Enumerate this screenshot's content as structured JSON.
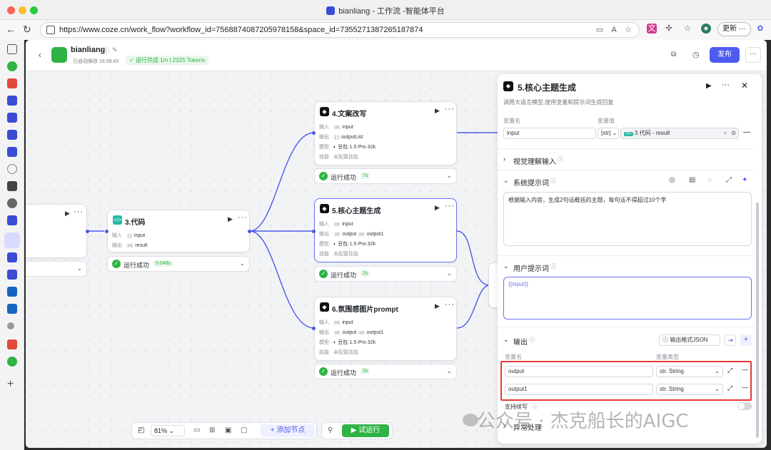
{
  "window": {
    "title": "bianliang - 工作流 -智能体平台",
    "url": "https://www.coze.cn/work_flow?workflow_id=7568874087205978158&space_id=7355271387265187874",
    "update_label": "更新"
  },
  "header": {
    "name": "bianliang",
    "autosave": "已自动保存 16:39:43",
    "status": "运行完成 1m | 2325 Tokens",
    "publish": "发布"
  },
  "nodes": {
    "left_partial": {},
    "code": {
      "title": "3.代码",
      "in_label": "输入",
      "in_value": "input",
      "out_label": "输出",
      "out_value": "result",
      "run": "运行成功",
      "time": "0.048s"
    },
    "rewrite": {
      "title": "4.文案改写",
      "in_label": "输入",
      "in_value": "input",
      "out_label": "输出",
      "out_value": "outputList",
      "model_label": "模型",
      "model": "豆包·1.5·Pro·32k",
      "skill_label": "技能",
      "skill": "未配置技能",
      "run": "运行成功",
      "time": "7s"
    },
    "core": {
      "title": "5.核心主题生成",
      "in_label": "输入",
      "in_value": "input",
      "out_label": "输出",
      "out_value": "output",
      "out_value2": "output1",
      "model_label": "模型",
      "model": "豆包·1.5·Pro·32k",
      "skill_label": "技能",
      "skill": "未配置技能",
      "run": "运行成功",
      "time": "2s"
    },
    "mood": {
      "title": "6.氛围感图片prompt",
      "in_label": "输入",
      "in_value": "input",
      "out_label": "输出",
      "out_value": "output",
      "out_value2": "output1",
      "model_label": "模型",
      "model": "豆包·1.5·Pro·32k",
      "skill_label": "技能",
      "skill": "未配置技能",
      "run": "运行成功",
      "time": "3s"
    }
  },
  "toolbar": {
    "zoom": "81%",
    "add_node": "添加节点",
    "test_run": "试运行"
  },
  "panel": {
    "title": "5.核心主题生成",
    "desc": "调用大语言模型,使用变量和提示词生成回复",
    "var_name_label": "变量名",
    "var_value_label": "变量值",
    "input_name": "input",
    "input_type": "str",
    "input_ref": "3.代码 - result",
    "vision": "视觉理解输入",
    "system_prompt": "系统提示词",
    "system_text": "根据输入内容，生成2句话概括的主题，每句话不得超过10个字",
    "user_prompt": "用户提示词",
    "user_text": "{{input}}",
    "output": "输出",
    "output_format": "输出格式JSON",
    "out_name_label": "变量名",
    "out_type_label": "变量类型",
    "outputs": [
      {
        "name": "output",
        "type": "str. String"
      },
      {
        "name": "output1",
        "type": "str. String"
      }
    ],
    "stream": "支持续写",
    "exception": "异常处理"
  },
  "watermark": "公众号 · 杰克船长的AIGC",
  "colors": {
    "accent": "#4e5bf0",
    "success": "#2fb344",
    "highlight": "#e53935"
  }
}
